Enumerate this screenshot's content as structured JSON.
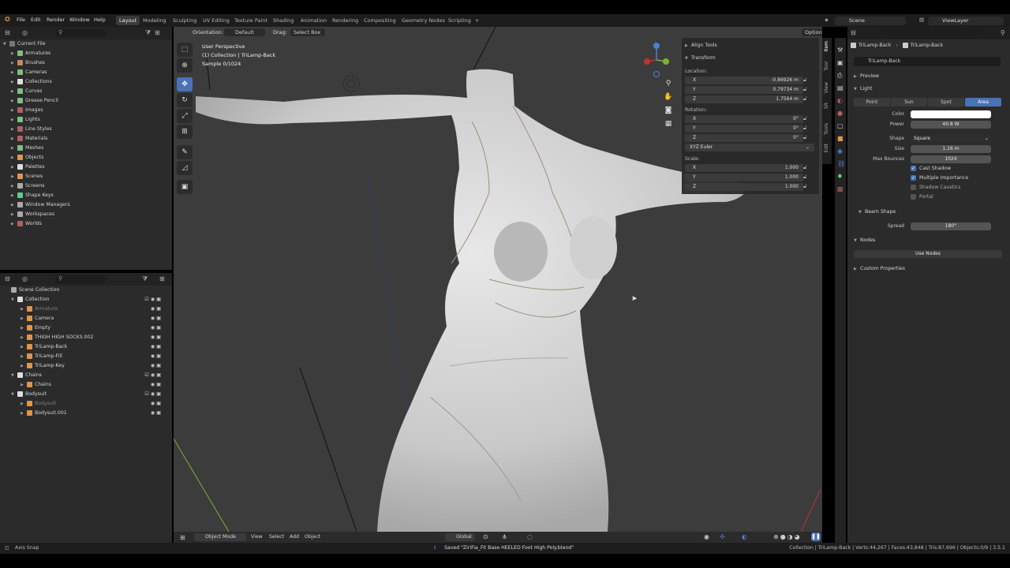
{
  "menubar": {
    "items": [
      "File",
      "Edit",
      "Render",
      "Window",
      "Help"
    ],
    "workspaces": [
      "Layout",
      "Modeling",
      "Sculpting",
      "UV Editing",
      "Texture Paint",
      "Shading",
      "Animation",
      "Rendering",
      "Compositing",
      "Geometry Nodes",
      "Scripting"
    ],
    "active_workspace": "Layout",
    "add_tab": "+",
    "scene_label": "Scene",
    "view_layer_label": "ViewLayer"
  },
  "outliner_top": {
    "title": "Current File",
    "items": [
      {
        "label": "Armatures",
        "color": "#7fbf7f"
      },
      {
        "label": "Brushes",
        "color": "#c08a5a"
      },
      {
        "label": "Cameras",
        "color": "#7fbf7f"
      },
      {
        "label": "Collections",
        "color": "#dddddd"
      },
      {
        "label": "Curves",
        "color": "#7fbf7f"
      },
      {
        "label": "Grease Pencil",
        "color": "#7fbf7f"
      },
      {
        "label": "Images",
        "color": "#b06060"
      },
      {
        "label": "Lights",
        "color": "#7fbf7f"
      },
      {
        "label": "Line Styles",
        "color": "#b06060"
      },
      {
        "label": "Materials",
        "color": "#b06060"
      },
      {
        "label": "Meshes",
        "color": "#7fbf7f"
      },
      {
        "label": "Objects",
        "color": "#e0954a"
      },
      {
        "label": "Palettes",
        "color": "#dddddd"
      },
      {
        "label": "Scenes",
        "color": "#e0954a"
      },
      {
        "label": "Screens",
        "color": "#aaaaaa"
      },
      {
        "label": "Shape Keys",
        "color": "#5ad08a"
      },
      {
        "label": "Window Managers",
        "color": "#aaaaaa"
      },
      {
        "label": "Workspaces",
        "color": "#aaaaaa"
      },
      {
        "label": "Worlds",
        "color": "#b06060"
      }
    ]
  },
  "outliner_bottom": {
    "root": "Scene Collection",
    "rows": [
      {
        "label": "Collection",
        "indent": 1,
        "kind": "collection"
      },
      {
        "label": "Armature",
        "indent": 2,
        "kind": "armature",
        "dim": true
      },
      {
        "label": "Camera",
        "indent": 2,
        "kind": "camera"
      },
      {
        "label": "Empty",
        "indent": 2,
        "kind": "empty"
      },
      {
        "label": "THIGH HIGH SOCKS.002",
        "indent": 2,
        "kind": "mesh"
      },
      {
        "label": "TriLamp-Back",
        "indent": 2,
        "kind": "light"
      },
      {
        "label": "TriLamp-Fill",
        "indent": 2,
        "kind": "light"
      },
      {
        "label": "TriLamp-Key",
        "indent": 2,
        "kind": "light"
      },
      {
        "label": "Chains",
        "indent": 1,
        "kind": "collection"
      },
      {
        "label": "Chains",
        "indent": 2,
        "kind": "mesh"
      },
      {
        "label": "Bodysuit",
        "indent": 1,
        "kind": "collection"
      },
      {
        "label": "Bodysuit",
        "indent": 2,
        "kind": "mesh",
        "dim": true
      },
      {
        "label": "Bodysuit.001",
        "indent": 2,
        "kind": "mesh"
      }
    ]
  },
  "viewport": {
    "orientation_label": "Orientation:",
    "orientation_value": "Default",
    "drag_label": "Drag:",
    "drag_value": "Select Box",
    "options_label": "Options",
    "overlay_line1": "User Perspective",
    "overlay_line2": "(1) Collection | TriLamp-Back",
    "overlay_line3": "Sample 0/1024",
    "footer": {
      "mode": "Object Mode",
      "menus": [
        "View",
        "Select",
        "Add",
        "Object"
      ],
      "transform": "Global"
    }
  },
  "npanel": {
    "align_tools": "Align Tools",
    "transform": "Transform",
    "location_label": "Location:",
    "location": [
      {
        "axis": "X",
        "value": "-0.86926 m"
      },
      {
        "axis": "Y",
        "value": "0.79734 m"
      },
      {
        "axis": "Z",
        "value": "1.7564 m"
      }
    ],
    "rotation_label": "Rotation:",
    "rotation": [
      {
        "axis": "X",
        "value": "0°"
      },
      {
        "axis": "Y",
        "value": "0°"
      },
      {
        "axis": "Z",
        "value": "0°"
      }
    ],
    "rotation_mode": "XYZ Euler",
    "scale_label": "Scale:",
    "scale": [
      {
        "axis": "X",
        "value": "1.000"
      },
      {
        "axis": "Y",
        "value": "1.000"
      },
      {
        "axis": "Z",
        "value": "1.000"
      }
    ],
    "tabs": [
      "Item",
      "Tool",
      "View",
      "SR",
      "Tools",
      "Edit"
    ]
  },
  "properties": {
    "breadcrumb_object": "TriLamp-Back",
    "breadcrumb_data": "TriLamp-Back",
    "data_name": "TriLamp-Back",
    "preview": "Preview",
    "light": "Light",
    "light_types": [
      "Point",
      "Sun",
      "Spot",
      "Area"
    ],
    "active_light_type": "Area",
    "color_label": "Color",
    "color_value": "#ffffff",
    "power_label": "Power",
    "power_value": "40.8 W",
    "shape_label": "Shape",
    "shape_value": "Square",
    "size_label": "Size",
    "size_value": "1.16 m",
    "max_bounces_label": "Max Bounces",
    "max_bounces_value": "1024",
    "cast_shadow": "Cast Shadow",
    "multiple_importance": "Multiple Importance",
    "shadow_caustics": "Shadow Caustics",
    "portal": "Portal",
    "beam_shape": "Beam Shape",
    "spread_label": "Spread",
    "spread_value": "180°",
    "nodes": "Nodes",
    "use_nodes": "Use Nodes",
    "custom_properties": "Custom Properties"
  },
  "statusbar": {
    "left": "Axis Snap",
    "message": "Saved \"ZiriFia_Fit Base HEELED Foot High Poly.blend\"",
    "right": "Collection | TriLamp-Back | Verts:44,267 | Faces:43,848 | Tris:87,696 | Objects:0/9 | 3.5.1"
  }
}
